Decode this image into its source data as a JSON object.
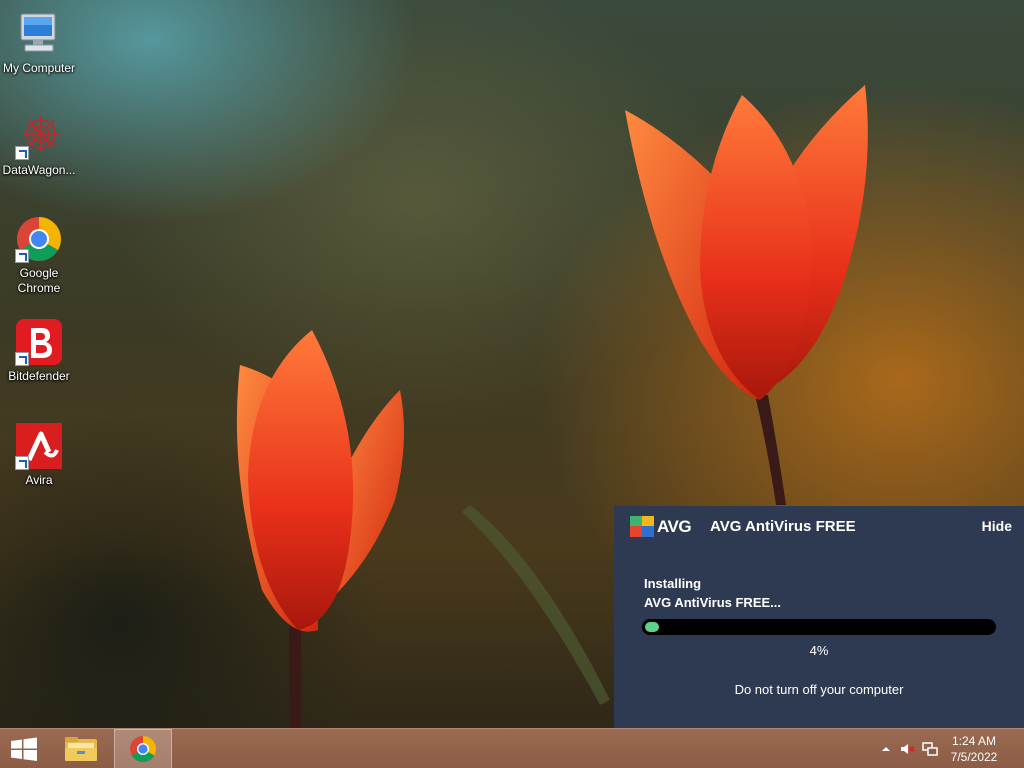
{
  "desktop": {
    "icons": [
      {
        "label": "My Computer",
        "icon": "computer-icon"
      },
      {
        "label": "DataWagon...",
        "icon": "datawagon-icon"
      },
      {
        "label": "Google Chrome",
        "icon": "chrome-icon"
      },
      {
        "label": "Bitdefender",
        "icon": "bitdefender-icon"
      },
      {
        "label": "Avira",
        "icon": "avira-icon"
      }
    ]
  },
  "avg": {
    "logo_text": "AVG",
    "title": "AVG AntiVirus FREE",
    "hide_label": "Hide",
    "status_line1": "Installing",
    "status_line2": "AVG AntiVirus FREE...",
    "progress_fraction": 0.04,
    "percent_label": "4%",
    "warning": "Do not turn off your computer",
    "colors": {
      "panel_bg": "#2d3a52",
      "progress_fill": "#5ed18a",
      "progress_track": "#000000"
    }
  },
  "taskbar": {
    "start_icon": "windows-logo-icon",
    "pinned": [
      {
        "icon": "file-explorer-icon"
      },
      {
        "icon": "chrome-icon",
        "active": true
      }
    ],
    "tray": {
      "icons": [
        "show-hidden-icons-icon",
        "speaker-muted-icon",
        "network-icon"
      ],
      "time": "1:24 AM",
      "date": "7/5/2022"
    },
    "colors": {
      "taskbar_bg": "#8c5c45"
    }
  }
}
